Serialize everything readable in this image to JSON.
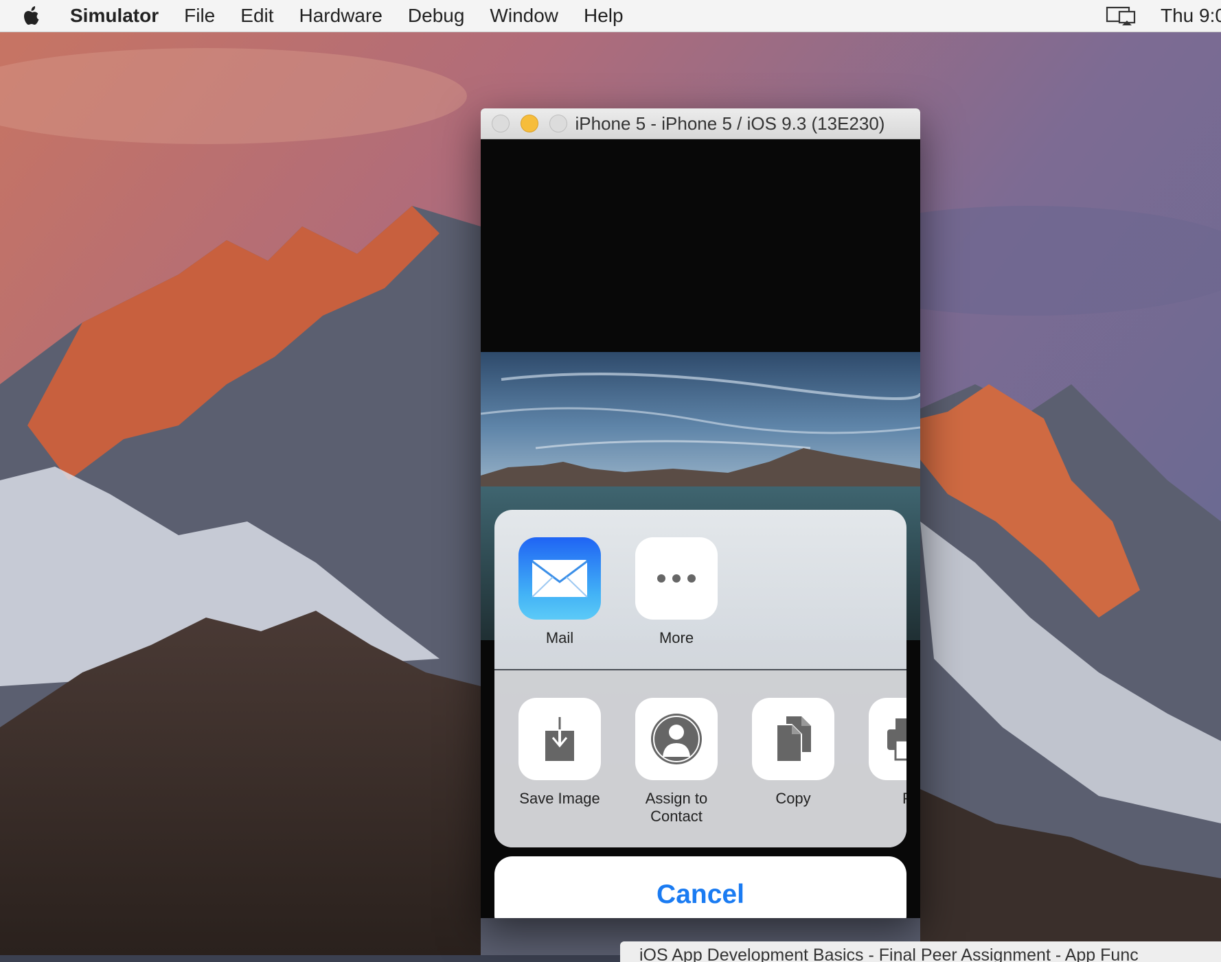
{
  "menubar": {
    "app_name": "Simulator",
    "items": [
      "File",
      "Edit",
      "Hardware",
      "Debug",
      "Window",
      "Help"
    ],
    "clock": "Thu 9:0"
  },
  "simulator": {
    "window_title": "iPhone 5 - iPhone 5 / iOS 9.3 (13E230)"
  },
  "share_sheet": {
    "apps": [
      {
        "label": "Mail",
        "icon": "mail-icon"
      },
      {
        "label": "More",
        "icon": "more-icon"
      }
    ],
    "actions": [
      {
        "label": "Save Image",
        "icon": "save-image-icon"
      },
      {
        "label": "Assign to\nContact",
        "icon": "contact-icon"
      },
      {
        "label": "Copy",
        "icon": "copy-icon"
      },
      {
        "label": "Pr",
        "icon": "print-icon"
      }
    ],
    "cancel_label": "Cancel",
    "accent_color": "#1a7bf2"
  },
  "bottom_window": {
    "title": "iOS App Development Basics - Final Peer Assignment - App Func"
  }
}
